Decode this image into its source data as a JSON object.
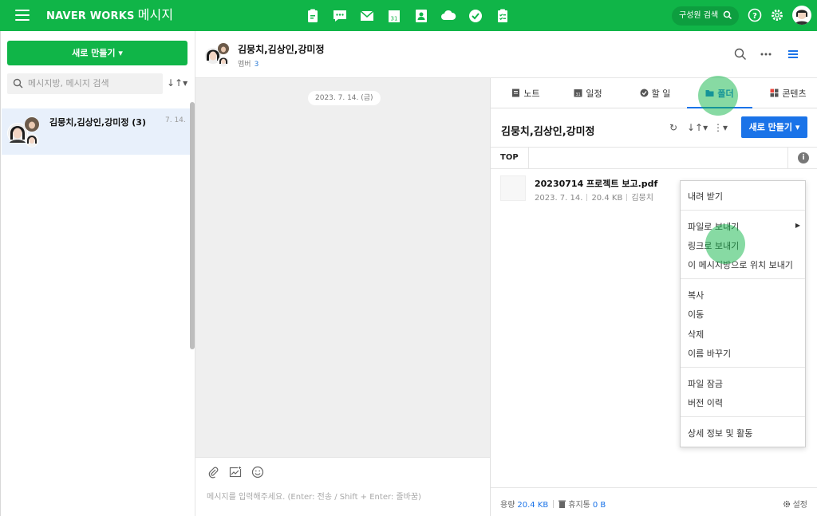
{
  "header": {
    "brand": "NAVER WORKS",
    "brand_sub": "메시지",
    "search_label": "구성원 검색",
    "apps": [
      "note-icon",
      "message-icon",
      "mail-icon",
      "calendar-icon",
      "contacts-icon",
      "drive-icon",
      "task-icon",
      "approval-icon"
    ]
  },
  "sidebar": {
    "new_button": "새로 만들기 ▾",
    "search_placeholder": "메시지방, 메시지 검색",
    "sort_label": "↓↑▾",
    "rooms": [
      {
        "name": "김뭉치,김상인,강미정 (3)",
        "date": "7. 14."
      }
    ]
  },
  "chat": {
    "title": "김뭉치,김상인,강미정",
    "members_label": "멤버",
    "members_count": "3",
    "date_chip": "2023. 7. 14. (금)",
    "compose_placeholder": "메시지를 입력해주세요. (Enter: 전송 / Shift + Enter: 줄바꿈)"
  },
  "panel": {
    "tabs": [
      {
        "label": "노트"
      },
      {
        "label": "일정"
      },
      {
        "label": "할 일"
      },
      {
        "label": "폴더"
      },
      {
        "label": "콘텐츠"
      }
    ],
    "title": "김뭉치,김상인,강미정",
    "new_button": "새로 만들기 ▾",
    "refresh": "↻",
    "sort": "↓↑▾",
    "more": "⋮▾",
    "breadcrumb": "TOP",
    "file": {
      "name": "20230714 프로젝트 보고.pdf",
      "date": "2023. 7. 14.",
      "size": "20.4 KB",
      "owner": "김뭉치"
    },
    "footer": {
      "usage_label": "용량",
      "usage_value": "20.4 KB",
      "trash_label": "휴지통",
      "trash_value": "0 B",
      "settings": "설정"
    }
  },
  "context_menu": {
    "download": "내려 받기",
    "send_file": "파일로 보내기",
    "send_link": "링크로 보내기",
    "send_location": "이 메시지방으로 위치 보내기",
    "copy": "복사",
    "move": "이동",
    "delete": "삭제",
    "rename": "이름 바꾸기",
    "lock": "파일 잠금",
    "versions": "버전 이력",
    "details": "상세 정보 및 활동"
  },
  "colors": {
    "brand_green": "#10b548",
    "accent_blue": "#1a73e8",
    "selected_row": "#e8f0fb"
  }
}
